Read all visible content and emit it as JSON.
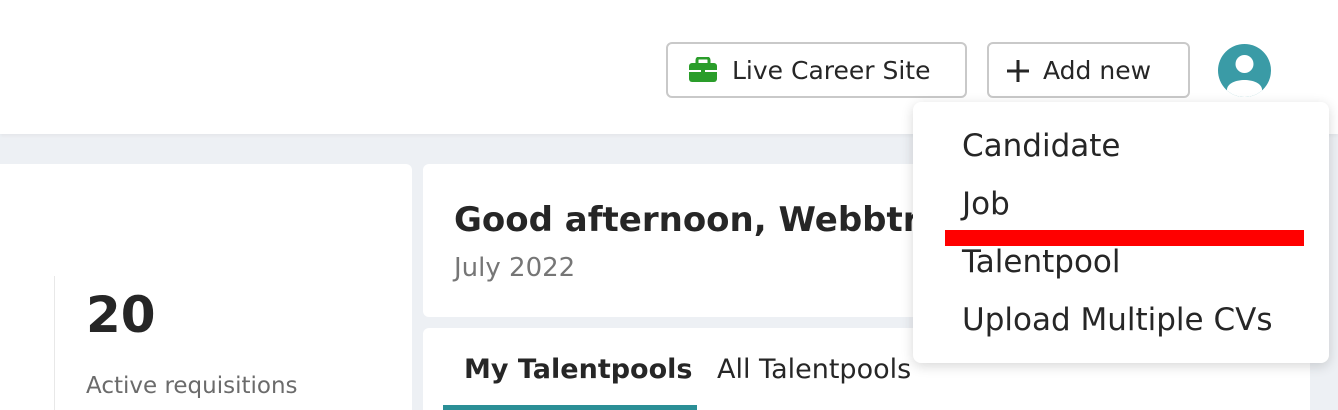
{
  "header": {
    "career_site_label": "Live Career Site",
    "add_new_label": "Add new",
    "icons": {
      "career": "briefcase-icon",
      "add": "plus-icon",
      "avatar": "user-avatar-icon"
    }
  },
  "dropdown": {
    "items": [
      {
        "label": "Candidate"
      },
      {
        "label": "Job"
      },
      {
        "label": "Talentpool"
      },
      {
        "label": "Upload Multiple CVs"
      }
    ]
  },
  "stats": {
    "active_requisitions_value": "20",
    "active_requisitions_label": "Active requisitions"
  },
  "greeting": {
    "text": "Good afternoon, Webbtre",
    "date": "July 2022"
  },
  "tabs": [
    {
      "label": "My Talentpools",
      "active": true
    },
    {
      "label": "All Talentpools",
      "active": false
    }
  ],
  "colors": {
    "accent": "#2b8f96",
    "avatar": "#3a9ba6",
    "briefcase": "#2a9d2a",
    "highlight": "#ff0000",
    "background": "#edf0f4"
  }
}
